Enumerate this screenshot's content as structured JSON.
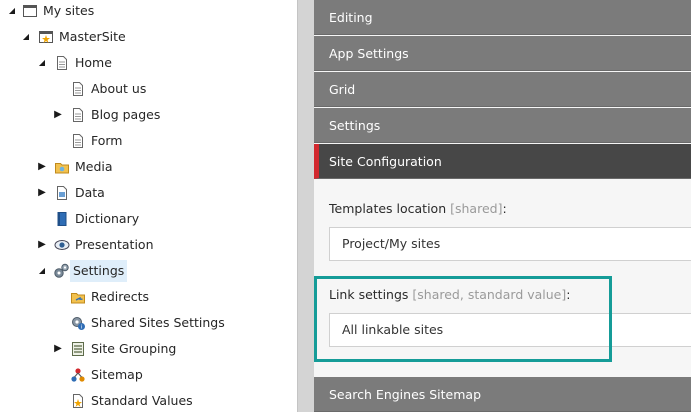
{
  "tree": {
    "items": [
      {
        "label": "My sites"
      },
      {
        "label": "MasterSite"
      },
      {
        "label": "Home"
      },
      {
        "label": "About us"
      },
      {
        "label": "Blog pages"
      },
      {
        "label": "Form"
      },
      {
        "label": "Media"
      },
      {
        "label": "Data"
      },
      {
        "label": "Dictionary"
      },
      {
        "label": "Presentation"
      },
      {
        "label": "Settings"
      },
      {
        "label": "Redirects"
      },
      {
        "label": "Shared Sites Settings"
      },
      {
        "label": "Site Grouping"
      },
      {
        "label": "Sitemap"
      },
      {
        "label": "Standard Values"
      }
    ]
  },
  "editor": {
    "sections": {
      "editing": "Editing",
      "app_settings": "App Settings",
      "grid": "Grid",
      "settings": "Settings",
      "site_configuration": "Site Configuration",
      "search_engines_sitemap": "Search Engines Sitemap"
    },
    "fields": {
      "templates_location": {
        "label": "Templates location",
        "meta": "[shared]",
        "colon": ":",
        "value": "Project/My sites"
      },
      "link_settings": {
        "label": "Link settings",
        "meta": "[shared, standard value]",
        "colon": ":",
        "value": "All linkable sites"
      }
    }
  },
  "colors": {
    "accent_red": "#d2282e",
    "highlight_teal": "#159c98",
    "section_gray": "#7b7b7b",
    "section_active": "#474747",
    "selected_bg": "#dfeefa"
  }
}
